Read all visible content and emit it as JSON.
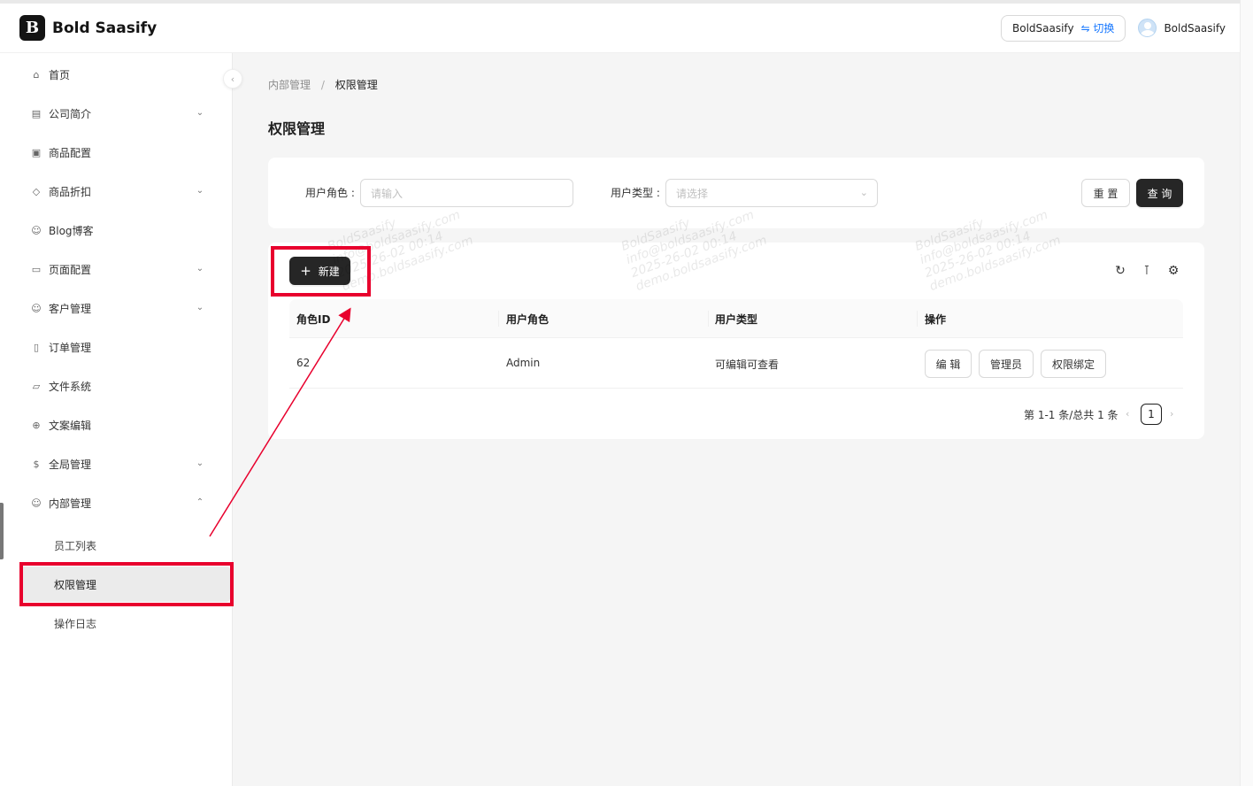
{
  "header": {
    "logo_text": "Bold Saasify",
    "tenant_name": "BoldSaasify",
    "tenant_switch": "⇋ 切换",
    "user_name": "BoldSaasify"
  },
  "sidebar": {
    "items": [
      {
        "label": "首页",
        "icon": "home-icon",
        "has_children": false
      },
      {
        "label": "公司简介",
        "icon": "building-icon",
        "has_children": true
      },
      {
        "label": "商品配置",
        "icon": "box-icon",
        "has_children": false
      },
      {
        "label": "商品折扣",
        "icon": "tag-icon",
        "has_children": true
      },
      {
        "label": "Blog博客",
        "icon": "team-icon",
        "has_children": false
      },
      {
        "label": "页面配置",
        "icon": "desktop-icon",
        "has_children": true
      },
      {
        "label": "客户管理",
        "icon": "team-icon",
        "has_children": true
      },
      {
        "label": "订单管理",
        "icon": "file-icon",
        "has_children": false
      },
      {
        "label": "文件系统",
        "icon": "folder-icon",
        "has_children": false
      },
      {
        "label": "文案编辑",
        "icon": "global-icon",
        "has_children": false
      },
      {
        "label": "全局管理",
        "icon": "dollar-icon",
        "has_children": true
      },
      {
        "label": "内部管理",
        "icon": "team-icon",
        "has_children": true,
        "expanded": true
      }
    ],
    "submenu": [
      {
        "label": "员工列表",
        "active": false
      },
      {
        "label": "权限管理",
        "active": true
      },
      {
        "label": "操作日志",
        "active": false
      }
    ]
  },
  "breadcrumb": {
    "parent": "内部管理",
    "separator": "/",
    "current": "权限管理"
  },
  "page_title": "权限管理",
  "filter": {
    "role_label": "用户角色 :",
    "role_placeholder": "请输入",
    "type_label": "用户类型 :",
    "type_placeholder": "请选择",
    "reset_label": "重 置",
    "query_label": "查 询"
  },
  "table": {
    "new_button": "新建",
    "columns": [
      "角色ID",
      "用户角色",
      "用户类型",
      "操作"
    ],
    "rows": [
      {
        "id": "62",
        "role": "Admin",
        "type": "可编辑可查看",
        "actions": [
          "编 辑",
          "管理员",
          "权限绑定"
        ]
      }
    ],
    "pagination": {
      "summary": "第 1-1 条/总共 1 条",
      "current_page": "1"
    }
  },
  "watermark": {
    "lines": [
      "BoldSaasify",
      "info@boldsaasify.com",
      "2025-26-02 00:14",
      "demo.boldsaasify.com"
    ]
  },
  "colors": {
    "primary": "#262626",
    "link": "#1677ff",
    "annotation": "#e8002d",
    "background": "#f5f5f5"
  }
}
